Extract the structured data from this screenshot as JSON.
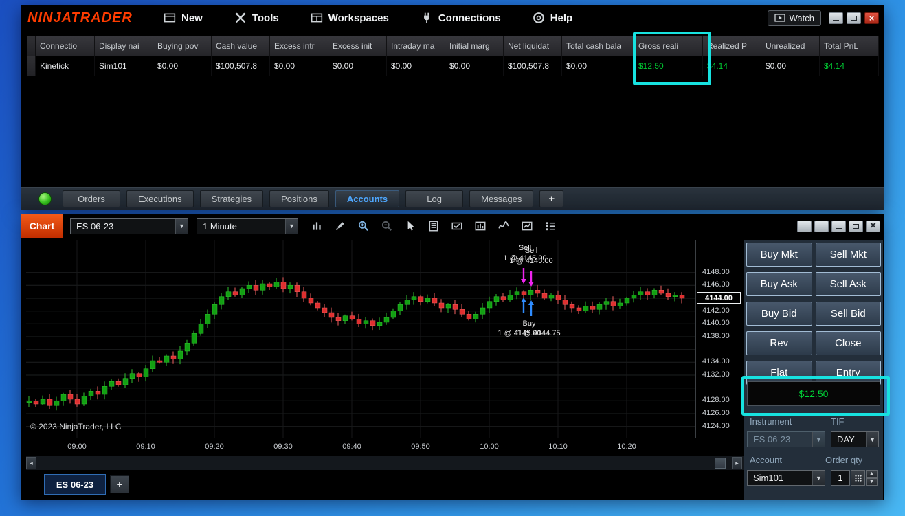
{
  "control_center": {
    "logo": "NINJATRADER",
    "menu": [
      "New",
      "Tools",
      "Workspaces",
      "Connections",
      "Help"
    ],
    "watch_label": "Watch",
    "table": {
      "columns": [
        "Connectio",
        "Display nai",
        "Buying pov",
        "Cash value",
        "Excess intr",
        "Excess init",
        "Intraday ma",
        "Initial marg",
        "Net liquidat",
        "Total cash bala",
        "Gross reali",
        "Realized P",
        "Unrealized",
        "Total PnL"
      ],
      "row": [
        "Kinetick",
        "Sim101",
        "$0.00",
        "$100,507.8",
        "$0.00",
        "$0.00",
        "$0.00",
        "$0.00",
        "$100,507.8",
        "$0.00",
        "$12.50",
        "$4.14",
        "$0.00",
        "$4.14"
      ],
      "green_cells": [
        10,
        11,
        13
      ]
    },
    "tabs": [
      "Orders",
      "Executions",
      "Strategies",
      "Positions",
      "Accounts",
      "Log",
      "Messages",
      "+"
    ],
    "selected_tab": "Accounts",
    "connection_status": "connected"
  },
  "chart_window": {
    "title": "Chart",
    "instrument_selector": "ES 06-23",
    "interval_selector": "1 Minute",
    "tab": "ES 06-23",
    "add_tab": "+",
    "copyright": "© 2023 NinjaTrader, LLC"
  },
  "chart_data": {
    "type": "candlestick",
    "instrument": "ES 06-23",
    "interval": "1 Minute",
    "start_time": "08:53",
    "x_ticks": [
      "09:00",
      "09:10",
      "09:20",
      "09:30",
      "09:40",
      "09:50",
      "10:00",
      "10:10",
      "10:20"
    ],
    "y_ticks": [
      "4148.00",
      "4146.00",
      "4142.00",
      "4140.00",
      "4138.00",
      "4134.00",
      "4132.00",
      "4128.00",
      "4126.00",
      "4124.00"
    ],
    "grid_prices": [
      4148,
      4146,
      4144,
      4142,
      4140,
      4138,
      4136,
      4134,
      4132,
      4130,
      4128,
      4126,
      4124
    ],
    "y_range": [
      4122.25,
      4153.0
    ],
    "last_price": "4144.00",
    "closes": [
      4128,
      4127.5,
      4128.25,
      4127.25,
      4128,
      4129,
      4128.25,
      4127.5,
      4128.75,
      4129.5,
      4129,
      4130.25,
      4131,
      4130.5,
      4131.5,
      4132.25,
      4131.75,
      4133,
      4134.25,
      4134,
      4135,
      4134.5,
      4135.75,
      4137,
      4138.5,
      4140,
      4141.5,
      4143,
      4144.25,
      4145,
      4144.5,
      4145.5,
      4146,
      4145.25,
      4146.25,
      4145.75,
      4146.5,
      4145.5,
      4146,
      4145,
      4144,
      4143.25,
      4142.5,
      4141.75,
      4141,
      4140.5,
      4141.25,
      4140.75,
      4140,
      4140.5,
      4139.75,
      4140.25,
      4141,
      4142,
      4143,
      4143.75,
      4144.25,
      4143.5,
      4144,
      4143.25,
      4142.5,
      4143,
      4142.25,
      4141.5,
      4140.75,
      4141.5,
      4142.5,
      4143.5,
      4144.25,
      4143.75,
      4144.5,
      4145,
      4144.5,
      4145.25,
      4144.75,
      4144,
      4144.5,
      4143.75,
      4143,
      4142.5,
      4142,
      4142.75,
      4142.25,
      4143,
      4143.5,
      4142.75,
      4143.25,
      4144,
      4144.5,
      4145,
      4144.5,
      4145.25,
      4144.75,
      4144.25,
      4144.5,
      4144
    ],
    "markers": {
      "index": 72,
      "sell": {
        "label": "Sell",
        "fill": "1 @ 4145.00"
      },
      "buy": {
        "label": "Buy",
        "fill_1": "1 @ 4145.00",
        "fill_2": "1 @ 4144.75"
      }
    }
  },
  "chart_trader": {
    "buttons": [
      "Buy Mkt",
      "Sell Mkt",
      "Buy Ask",
      "Sell Ask",
      "Buy Bid",
      "Sell Bid",
      "Rev",
      "Close",
      "Flat",
      "Entry"
    ],
    "pnl": "$12.50",
    "labels": {
      "instrument": "Instrument",
      "tif": "TIF",
      "account": "Account",
      "order_qty": "Order qty"
    },
    "instrument_value": "ES 06-23",
    "tif_value": "DAY",
    "account_value": "Sim101",
    "qty_value": "1"
  },
  "colors": {
    "accent_cyan": "#17e2e0",
    "pnl_green": "#00cc33",
    "logo_orange": "#ff3c00",
    "chart_label_bg": "#e13c00",
    "tab_active_blue": "#4fa8ff",
    "up": "#13a013",
    "up_edge": "#2fc42f",
    "down": "#df3030",
    "down_edge": "#f26060",
    "sell_arrow": "#f024f0",
    "buy_arrow": "#2f8cff"
  }
}
